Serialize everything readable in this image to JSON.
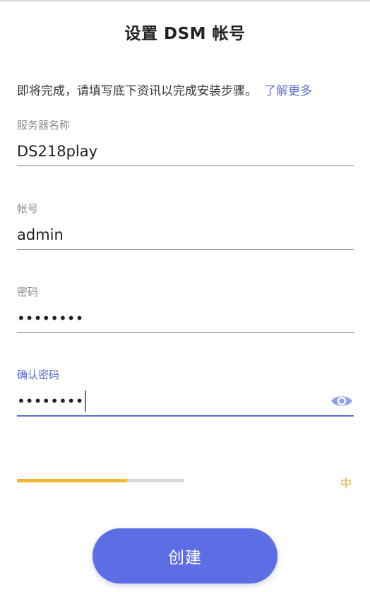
{
  "header": {
    "title": "设置 DSM 帐号"
  },
  "intro": {
    "text": "即将完成，请填写底下资讯以完成安装步骤。",
    "link_label": "了解更多"
  },
  "form": {
    "server_name": {
      "label": "服务器名称",
      "value": "DS218play"
    },
    "account": {
      "label": "帐号",
      "value": "admin"
    },
    "password": {
      "label": "密码",
      "value": "••••••••"
    },
    "confirm_password": {
      "label": "确认密码",
      "value": "••••••••",
      "toggle_icon": "eye-icon"
    }
  },
  "strength": {
    "level_fraction": 0.66,
    "label": "中",
    "color": "#f2b634"
  },
  "actions": {
    "create_label": "创建"
  },
  "colors": {
    "accent": "#5b6fd0",
    "button": "#5b6ee6",
    "strength_text": "#e8a92a"
  }
}
